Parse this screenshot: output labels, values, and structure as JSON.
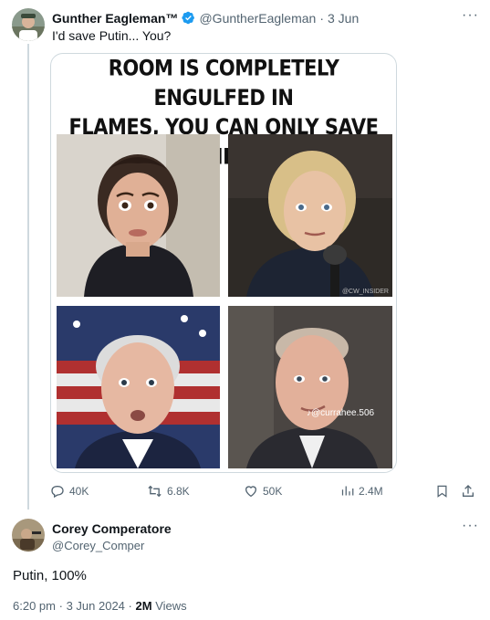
{
  "colors": {
    "accent": "#1d9bf0",
    "muted": "#536471",
    "text": "#0f1419",
    "line": "#cfd9de"
  },
  "tweet": {
    "author_name": "Gunther Eagleman™",
    "author_handle": "@GuntherEagleman",
    "separator": "·",
    "date": "3 Jun",
    "text": "I'd save Putin...  You?",
    "verified_icon": "verified-badge-icon",
    "more_label": "···",
    "media": {
      "meme_title_line1": "ROOM IS COMPLETELY ENGULFED IN",
      "meme_title_line2": "FLAMES, YOU CAN ONLY SAVE ONE...",
      "corner_watermark": "@CW_INSIDER",
      "tiktok_watermark": "♪@currahee.506"
    },
    "stats": {
      "replies": "40K",
      "reposts": "6.8K",
      "likes": "50K",
      "views": "2.4M"
    }
  },
  "reply": {
    "author_name": "Corey Comperatore",
    "author_handle": "@Corey_Comper",
    "more_label": "···",
    "text": "Putin, 100%",
    "time": "6:20 pm",
    "date": "3 Jun 2024",
    "views_count": "2M",
    "views_label": "Views",
    "separator": "·"
  }
}
